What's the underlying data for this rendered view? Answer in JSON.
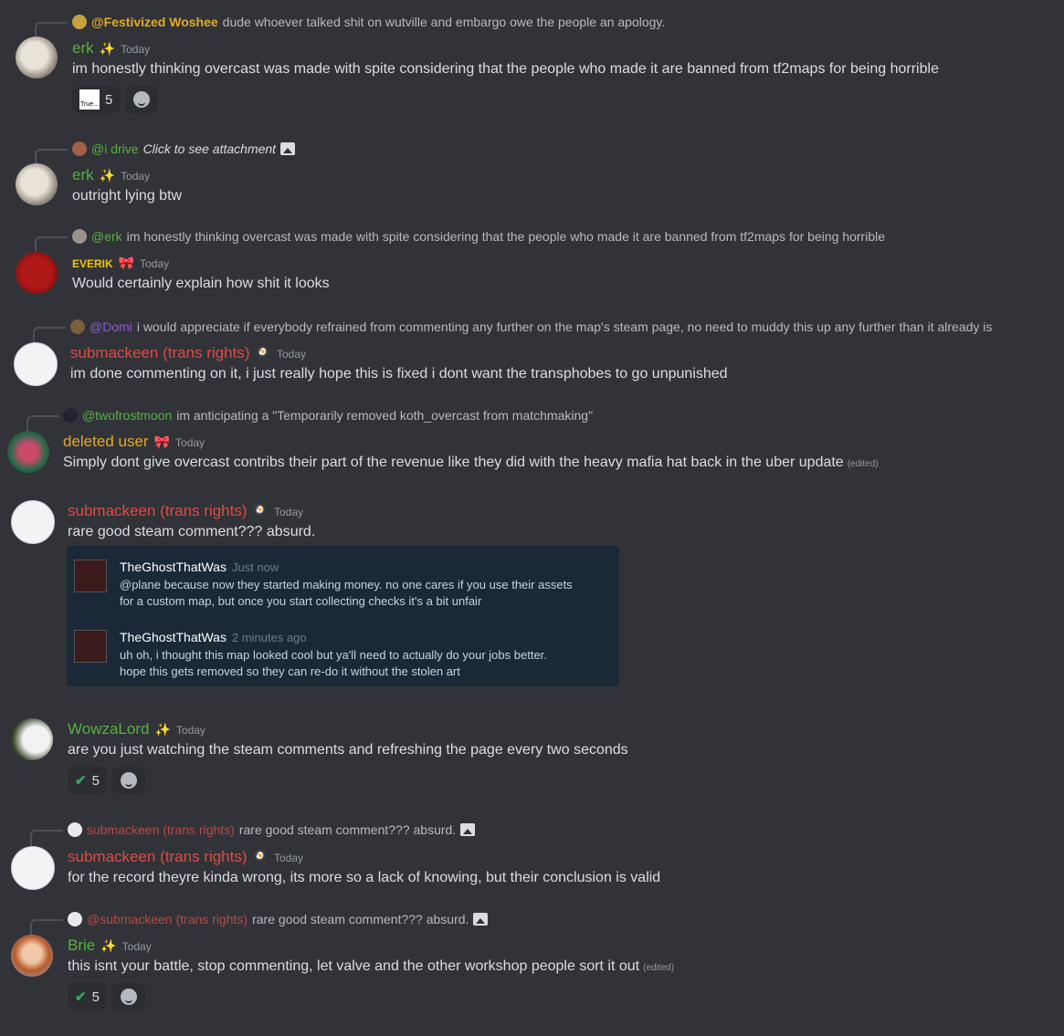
{
  "colors": {
    "background": "#313338",
    "green_name": "#57b044",
    "red_name": "#e04a44",
    "yellow_name": "#e2a92a",
    "purple_name": "#8e5bd0",
    "everik_name": "#f1c40f"
  },
  "messages": [
    {
      "reply_name": "@Festivized Woshee",
      "reply_text": "dude whoever talked shit on wutville and embargo owe the people an apology.",
      "name": "erk",
      "badge": "✨",
      "time": "Today",
      "text": "im honestly thinking overcast was made with spite considering that the people who made it are banned from tf2maps for being horrible",
      "reactions": [
        {
          "emoji": "True...",
          "count": "5"
        }
      ]
    },
    {
      "reply_name": "@i drive",
      "reply_text": "Click to see attachment",
      "name": "erk",
      "badge": "✨",
      "time": "Today",
      "text": "outright lying btw"
    },
    {
      "reply_name": "@erk",
      "reply_text": "im honestly thinking overcast was made with spite considering that the people who made it are banned from tf2maps for being horrible",
      "name": "EVERIK",
      "badge": "🎀",
      "time": "Today",
      "text": "Would certainly explain how shit it looks"
    },
    {
      "reply_name": "@Domi",
      "reply_text": "i would appreciate if everybody refrained from commenting any further on the map's steam page, no need to muddy this up any further than it already is",
      "name": "submackeen (trans rights)",
      "badge": "🍳",
      "time": "Today",
      "text": "im done commenting on it, i just really hope this is fixed i dont want the transphobes to go unpunished"
    },
    {
      "reply_name": "@twofrostmoon",
      "reply_text": "im anticipating a \"Temporarily removed koth_overcast from matchmaking\"",
      "name": "deleted user",
      "badge": "🎀",
      "time": "Today",
      "text": "Simply dont give overcast contribs their part of the revenue like they did with the heavy mafia hat back in the uber update",
      "edited": "(edited)"
    },
    {
      "name": "submackeen (trans rights)",
      "badge": "🍳",
      "time": "Today",
      "text": "rare good steam comment??? absurd.",
      "embed": [
        {
          "name": "TheGhostThatWas",
          "time": "Just now",
          "line1": "@plane because now they started making money. no one cares if you use their assets",
          "line2": "for a custom map, but once you start collecting checks it's a bit unfair"
        },
        {
          "name": "TheGhostThatWas",
          "time": "2 minutes ago",
          "line1": "uh oh, i thought this map looked cool but ya'll need to actually do your jobs better.",
          "line2": "hope this gets removed so they can re-do it without the stolen art"
        }
      ]
    },
    {
      "name": "WowzaLord",
      "badge": "✨",
      "time": "Today",
      "text": "are you just watching the steam comments and refreshing the page every two seconds",
      "reactions": [
        {
          "emoji": "✔",
          "count": "5"
        }
      ]
    },
    {
      "reply_name": "submackeen (trans rights)",
      "reply_text": "rare good steam comment??? absurd.",
      "name": "submackeen (trans rights)",
      "badge": "🍳",
      "time": "Today",
      "text": "for the record theyre kinda wrong, its more so a lack of knowing, but their conclusion is valid"
    },
    {
      "reply_name": "@submackeen (trans rights)",
      "reply_text": "rare good steam comment??? absurd.",
      "name": "Brie",
      "badge": "✨",
      "time": "Today",
      "text": "this isnt your battle, stop commenting, let valve and the other workshop people sort it out",
      "edited": "(edited)",
      "reactions": [
        {
          "emoji": "✔",
          "count": "5"
        }
      ]
    }
  ]
}
